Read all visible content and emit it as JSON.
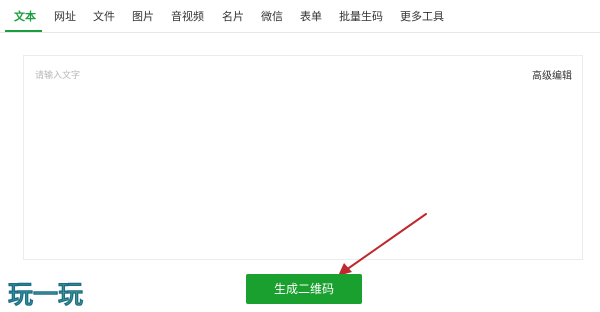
{
  "tabs": [
    {
      "label": "文本",
      "active": true
    },
    {
      "label": "网址"
    },
    {
      "label": "文件"
    },
    {
      "label": "图片"
    },
    {
      "label": "音视频"
    },
    {
      "label": "名片"
    },
    {
      "label": "微信"
    },
    {
      "label": "表单"
    },
    {
      "label": "批量生码"
    },
    {
      "label": "更多工具"
    }
  ],
  "editor": {
    "placeholder": "请输入文字",
    "advanced_label": "高级编辑"
  },
  "generate_button": {
    "label": "生成二维码"
  },
  "watermark": {
    "text": "玩一玩"
  },
  "colors": {
    "accent": "#1b9e3e",
    "button": "#19a02f",
    "annotation_arrow": "#c0282d"
  }
}
